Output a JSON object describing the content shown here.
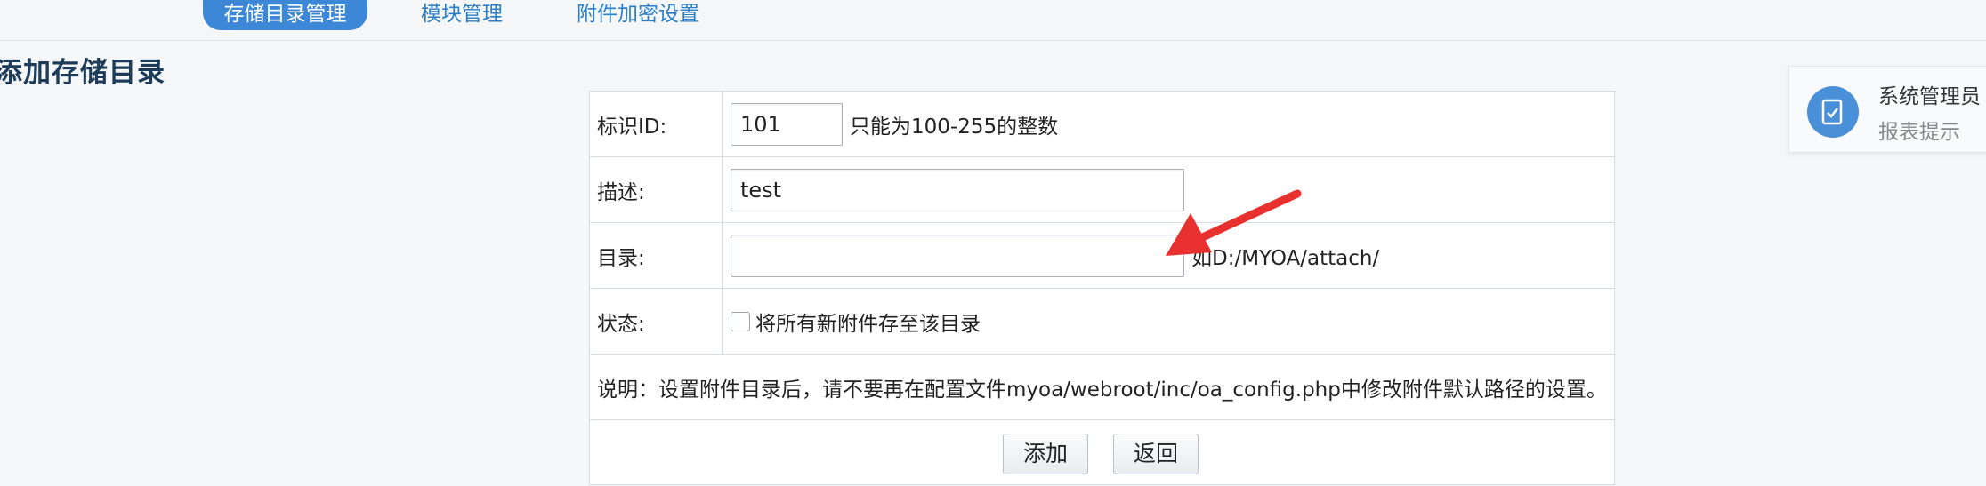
{
  "tabs": [
    {
      "label": "存储目录管理",
      "active": true
    },
    {
      "label": "模块管理",
      "active": false
    },
    {
      "label": "附件加密设置",
      "active": false
    }
  ],
  "page_title": "添加存储目录",
  "form": {
    "id_label": "标识ID:",
    "id_value": "101",
    "id_hint": "只能为100-255的整数",
    "desc_label": "描述:",
    "desc_value": "test",
    "dir_label": "目录:",
    "dir_value": "",
    "dir_hint": "如D:/MYOA/attach/",
    "status_label": "状态:",
    "status_checkbox_label": "将所有新附件存至该目录",
    "status_checked": false,
    "note": "说明：设置附件目录后，请不要再在配置文件myoa/webroot/inc/oa_config.php中修改附件默认路径的设置。"
  },
  "buttons": {
    "add": "添加",
    "back": "返回"
  },
  "notification": {
    "name": "系统管理员",
    "subtitle": "报表提示"
  },
  "colors": {
    "accent": "#3d88d6",
    "tab_text": "#2a7fc7",
    "arrow": "#e8302e",
    "title": "#1d3c5a"
  }
}
